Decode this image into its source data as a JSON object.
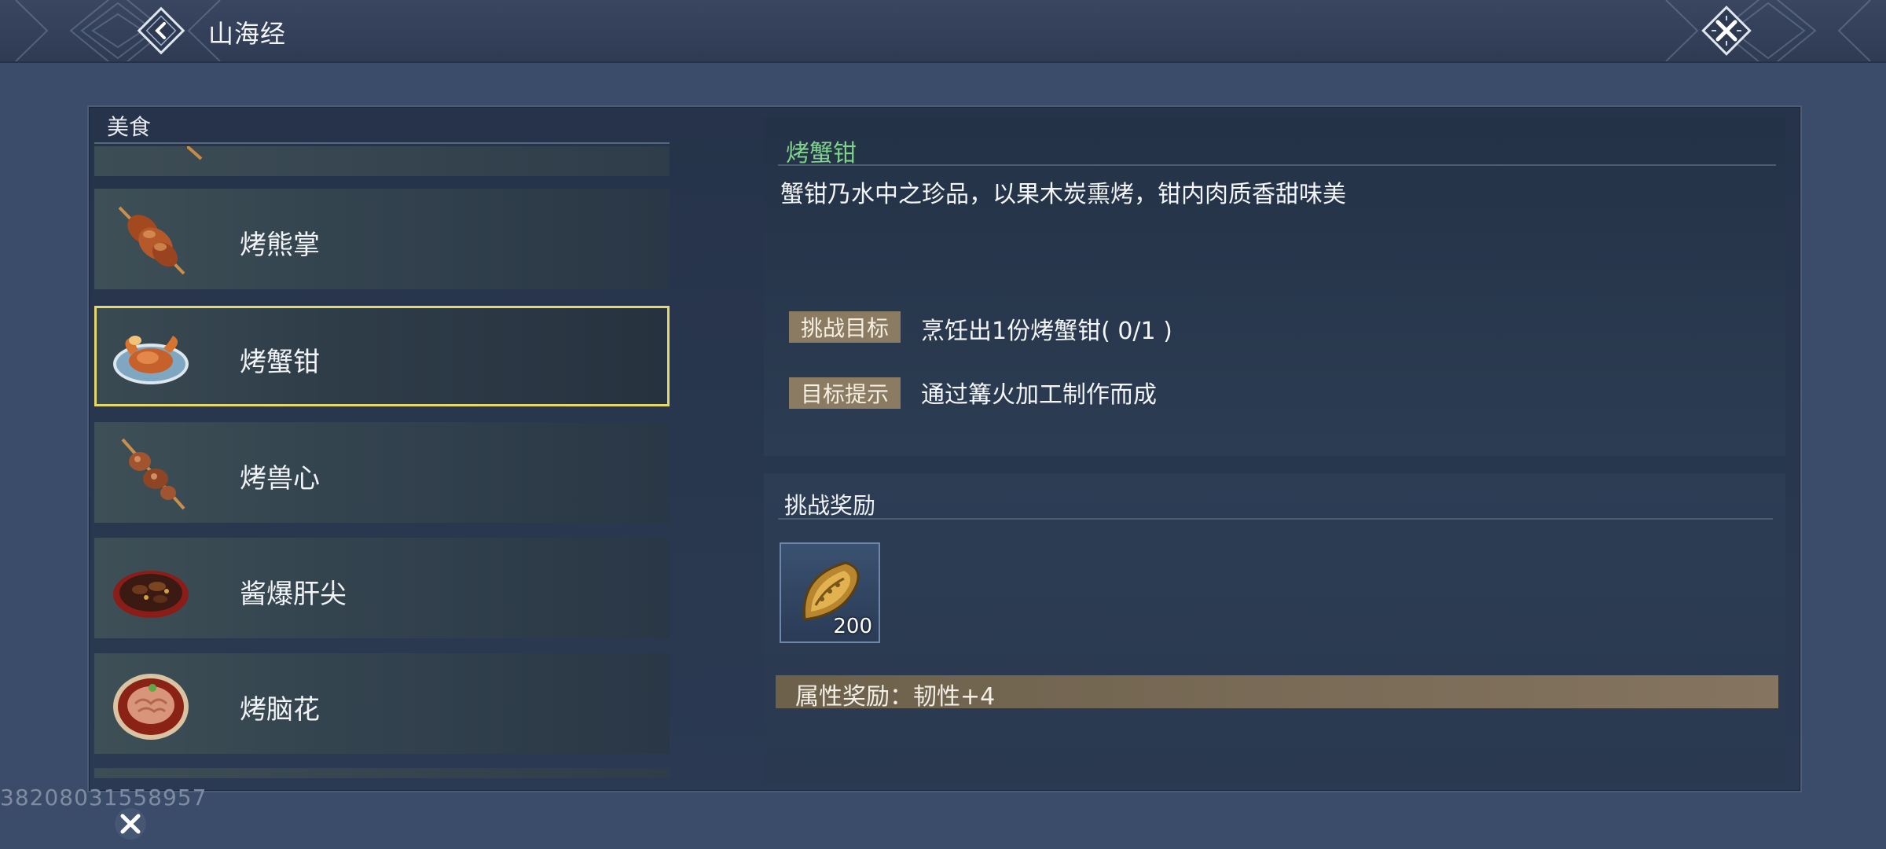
{
  "header": {
    "title": "山海经"
  },
  "category": {
    "title": "美食"
  },
  "food_list": [
    {
      "label": "烤熊掌",
      "icon": "roast-bear-paw-icon"
    },
    {
      "label": "烤蟹钳",
      "icon": "roast-crab-claw-icon",
      "selected": true
    },
    {
      "label": "烤兽心",
      "icon": "roast-beast-heart-icon"
    },
    {
      "label": "酱爆肝尖",
      "icon": "sauteed-liver-icon"
    },
    {
      "label": "烤脑花",
      "icon": "roast-brain-icon"
    }
  ],
  "detail": {
    "name": "烤蟹钳",
    "description": "蟹钳乃水中之珍品，以果木炭熏烤，钳内肉质香甜味美",
    "challenge_goal_label": "挑战目标",
    "challenge_goal_value": "烹饪出1份烤蟹钳( 0/1 )",
    "goal_hint_label": "目标提示",
    "goal_hint_value": "通过篝火加工制作而成"
  },
  "reward": {
    "title": "挑战奖励",
    "item_icon": "golden-shell-icon",
    "item_count": "200",
    "attribute": "属性奖励：韧性+4"
  },
  "footer": {
    "uid": "38208031558957"
  },
  "colors": {
    "background": "#3b4c6a",
    "selected_border": "#e5d86a",
    "detail_name": "#7fd38a",
    "tag_bg": "#8a7b62"
  }
}
